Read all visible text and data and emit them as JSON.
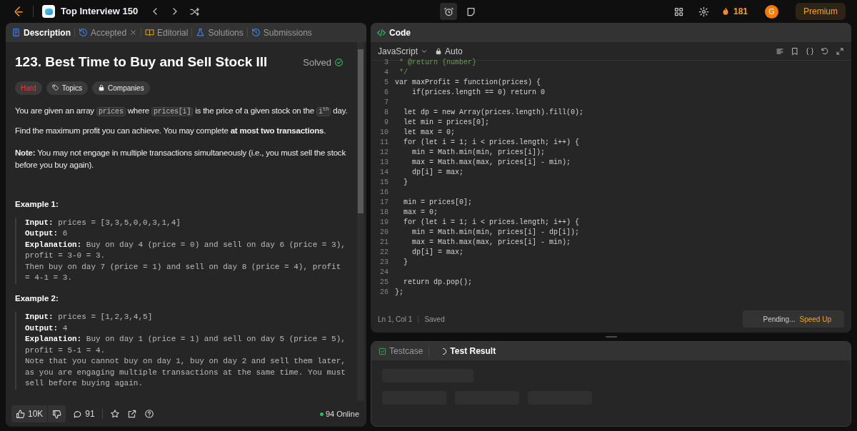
{
  "top_bar": {
    "list_title": "Top Interview 150",
    "streak": "181",
    "avatar": "G",
    "premium": "Premium"
  },
  "left_tabs": [
    {
      "label": "Description",
      "selected": true,
      "kind": "doc"
    },
    {
      "label": "Accepted",
      "selected": false,
      "kind": "history",
      "closable": true
    },
    {
      "label": "Editorial",
      "selected": false,
      "kind": "book"
    },
    {
      "label": "Solutions",
      "selected": false,
      "kind": "flask"
    },
    {
      "label": "Submissions",
      "selected": false,
      "kind": "history"
    }
  ],
  "problem": {
    "title": "123. Best Time to Buy and Sell Stock III",
    "status": "Solved",
    "difficulty": "Hard",
    "tags": [
      "Topics",
      "Companies"
    ],
    "paragraphs": [
      [
        {
          "kind": "text",
          "s": "You are given an array "
        },
        {
          "kind": "code",
          "s": "prices"
        },
        {
          "kind": "text",
          "s": " where "
        },
        {
          "kind": "code",
          "s": "prices[i]"
        },
        {
          "kind": "text",
          "s": " is the price of a given stock on the "
        },
        {
          "kind": "code",
          "s": "i$^{th}$"
        },
        {
          "kind": "text",
          "s": " day."
        }
      ],
      [
        {
          "kind": "text",
          "s": "Find the maximum profit you can achieve. You may complete **at most two transactions**."
        }
      ],
      [
        {
          "kind": "text",
          "s": "**Note:** You may not engage in multiple transactions simultaneously (i.e., you must sell the stock before you buy again)."
        }
      ]
    ],
    "examples": [
      {
        "title": "Example 1:",
        "lines": [
          {
            "label": "Input:",
            "text": "prices = [3,3,5,0,0,3,1,4]"
          },
          {
            "label": "Output:",
            "text": "6"
          },
          {
            "label": "Explanation:",
            "text": "Buy on day 4 (price = 0) and sell on day 6 (price = 3), profit = 3-0 = 3."
          },
          {
            "text": "Then buy on day 7 (price = 1) and sell on day 8 (price = 4), profit = 4-1 = 3."
          }
        ]
      },
      {
        "title": "Example 2:",
        "lines": [
          {
            "label": "Input:",
            "text": "prices = [1,2,3,4,5]"
          },
          {
            "label": "Output:",
            "text": "4"
          },
          {
            "label": "Explanation:",
            "text": "Buy on day 1 (price = 1) and sell on day 5 (price = 5), profit = 5-1 = 4."
          },
          {
            "text": "Note that you cannot buy on day 1, buy on day 2 and sell them later, as you are engaging multiple transactions at the same time. You must sell before buying again."
          }
        ]
      }
    ]
  },
  "left_footer": {
    "likes": "10K",
    "comments": "91",
    "online": "94 Online"
  },
  "code_panel": {
    "title": "Code",
    "language": "JavaScript",
    "mode": "Auto",
    "lines": [
      {
        "n": "3",
        "s": " * @return {number}",
        "kind": "comment"
      },
      {
        "n": "4",
        "s": " */",
        "kind": "comment"
      },
      {
        "n": "5",
        "s": "var maxProfit = function(prices) {",
        "kind": "code"
      },
      {
        "n": "6",
        "s": "    if(prices.length == 0) return 0",
        "kind": "code"
      },
      {
        "n": "7",
        "kind": "code"
      },
      {
        "n": "8",
        "s": "  let dp = new Array(prices.length).fill(0);",
        "kind": "code"
      },
      {
        "n": "9",
        "s": "  let min = prices[0];",
        "kind": "code"
      },
      {
        "n": "10",
        "s": "  let max = 0;",
        "kind": "code"
      },
      {
        "n": "11",
        "s": "  for (let i = 1; i < prices.length; i++) {",
        "kind": "code"
      },
      {
        "n": "12",
        "s": "    min = Math.min(min, prices[i]);",
        "kind": "code"
      },
      {
        "n": "13",
        "s": "    max = Math.max(max, prices[i] - min);",
        "kind": "code"
      },
      {
        "n": "14",
        "s": "    dp[i] = max;",
        "kind": "code"
      },
      {
        "n": "15",
        "s": "  }",
        "kind": "code"
      },
      {
        "n": "16",
        "kind": "code"
      },
      {
        "n": "17",
        "s": "  min = prices[0];",
        "kind": "code"
      },
      {
        "n": "18",
        "s": "  max = 0;",
        "kind": "code"
      },
      {
        "n": "19",
        "s": "  for (let i = 1; i < prices.length; i++) {",
        "kind": "code"
      },
      {
        "n": "20",
        "s": "    min = Math.min(min, prices[i] - dp[i]);",
        "kind": "code"
      },
      {
        "n": "21",
        "s": "    max = Math.max(max, prices[i] - min);",
        "kind": "code"
      },
      {
        "n": "22",
        "s": "    dp[i] = max;",
        "kind": "code"
      },
      {
        "n": "23",
        "s": "  }",
        "kind": "code"
      },
      {
        "n": "24",
        "kind": "code"
      },
      {
        "n": "25",
        "s": "  return dp.pop();",
        "kind": "code"
      },
      {
        "n": "26",
        "s": "};",
        "kind": "code"
      }
    ],
    "cursor": "Ln 1, Col 1",
    "save_state": "Saved",
    "pending": "Pending...",
    "speed_up": "Speed Up"
  },
  "test_tabs": [
    {
      "label": "Testcase",
      "selected": false,
      "kind": "check"
    },
    {
      "label": "Test Result",
      "selected": true,
      "kind": "spinner"
    }
  ]
}
